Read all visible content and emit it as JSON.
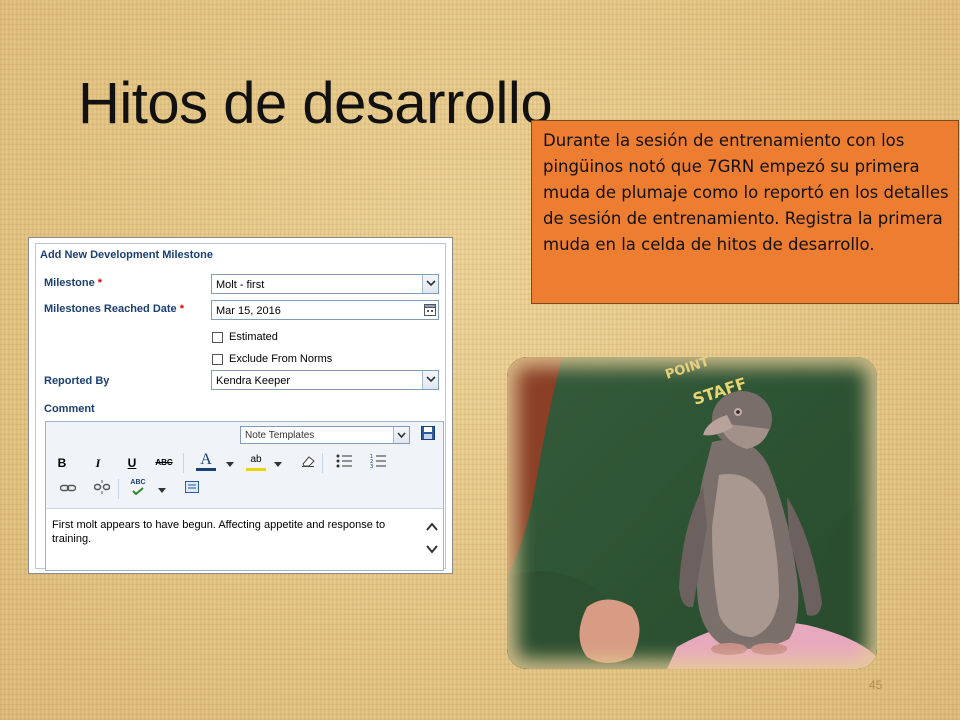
{
  "slide": {
    "title": "Hitos de desarrollo",
    "page_number": "45"
  },
  "callout": {
    "text": "Durante la sesión de entrenamiento con los pingüinos notó que 7GRN empezó su primera muda de plumaje como lo reportó en los detalles de sesión de entrenamiento.  Registra la primera muda en la celda de hitos de desarrollo.",
    "color": "#ed7d31"
  },
  "form": {
    "title": "Add New Development Milestone",
    "milestone_label": "Milestone",
    "required_marker": "*",
    "milestone_value": "Molt - first",
    "date_label": "Milestones Reached Date",
    "date_value": "Mar 15, 2016",
    "estimated_label": "Estimated",
    "exclude_label": "Exclude From Norms",
    "reported_by_label": "Reported By",
    "reported_by_value": "Kendra Keeper",
    "comment_label": "Comment",
    "note_templates_placeholder": "Note Templates",
    "comment_text": "First molt appears to have begun. Affecting appetite and response to training.",
    "label_color": "#1b3f74"
  },
  "toolbar": {
    "bold": "B",
    "italic": "I",
    "underline": "U",
    "strike": "ABC",
    "font_color": "A",
    "highlight": "ab",
    "spell": "ABC"
  },
  "photo": {
    "shirt_text_1": "POINT",
    "shirt_text_2": "STAFF"
  }
}
